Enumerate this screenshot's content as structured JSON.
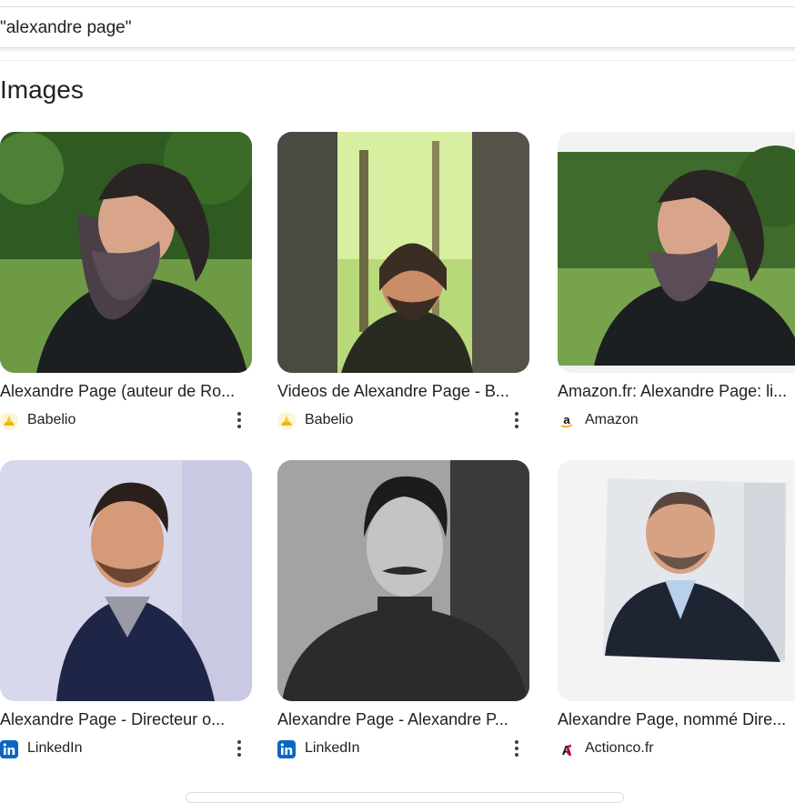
{
  "search": {
    "query": "\"alexandre page\""
  },
  "section": {
    "title": "Images"
  },
  "results": [
    {
      "caption": "Alexandre Page (auteur de Ro...",
      "source": "Babelio",
      "favicon": "babelio-icon"
    },
    {
      "caption": "Videos de Alexandre Page - B...",
      "source": "Babelio",
      "favicon": "babelio-icon"
    },
    {
      "caption": "Amazon.fr: Alexandre Page: li...",
      "source": "Amazon",
      "favicon": "amazon-icon"
    },
    {
      "caption": "Alexandre Page - Directeur o...",
      "source": "LinkedIn",
      "favicon": "linkedin-icon"
    },
    {
      "caption": "Alexandre Page - Alexandre P...",
      "source": "LinkedIn",
      "favicon": "linkedin-icon"
    },
    {
      "caption": "Alexandre Page, nommé Dire...",
      "source": "Actionco.fr",
      "favicon": "actionco-icon"
    }
  ],
  "colors": {
    "linkedin": "#0a66c2",
    "babelio": "#f2b705",
    "actionco": "#d6006b"
  }
}
